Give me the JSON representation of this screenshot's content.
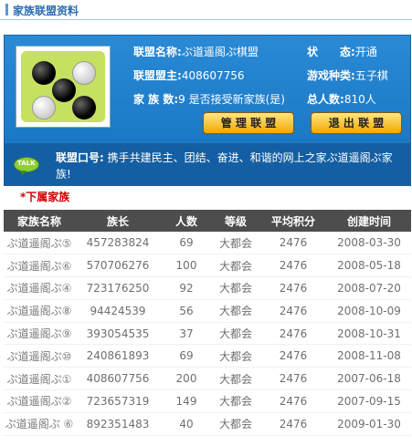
{
  "section_title": "家族联盟资料",
  "alliance": {
    "name_label": "联盟名称:",
    "name_value": "ぷ道遥阁ぷ棋盟",
    "leader_label": "联盟盟主:",
    "leader_value": "408607756",
    "families_label": "家 族 数:",
    "families_value": "9 是否接受新家族(是)",
    "status_label": "状　　态:",
    "status_value": "开通",
    "game_label": "游戏种类:",
    "game_value": "五子棋",
    "population_label": "总人数:",
    "population_value": "810人",
    "manage_button": "管 理 联 盟",
    "quit_button": "退 出 联 盟",
    "slogan_label": "联盟口号:",
    "slogan_value": "携手共建民主、团结、奋进、和谐的网上之家ぷ道遥阁ぷ家族!",
    "talk_icon_text": "TALK"
  },
  "sub_families_title": "*下属家族",
  "table": {
    "headers": [
      "家族名称",
      "族长",
      "人数",
      "等级",
      "平均积分",
      "创建时间"
    ],
    "rows": [
      {
        "name": "ぷ道遥阁ぷ⑤",
        "leader": "457283824",
        "members": "69",
        "level": "大都会",
        "avg": "2476",
        "created": "2008-03-30"
      },
      {
        "name": "ぷ道遥阁ぷ⑥",
        "leader": "570706276",
        "members": "100",
        "level": "大都会",
        "avg": "2476",
        "created": "2008-05-18"
      },
      {
        "name": "ぷ道遥阁ぷ④",
        "leader": "723176250",
        "members": "92",
        "level": "大都会",
        "avg": "2476",
        "created": "2008-07-20"
      },
      {
        "name": "ぷ道遥阁ぷ⑧",
        "leader": "94424539",
        "members": "56",
        "level": "大都会",
        "avg": "2476",
        "created": "2008-10-09"
      },
      {
        "name": "ぷ道遥阁ぷ⑨",
        "leader": "393054535",
        "members": "37",
        "level": "大都会",
        "avg": "2476",
        "created": "2008-10-31"
      },
      {
        "name": "ぷ道遥阁ぷ⑩",
        "leader": "240861893",
        "members": "69",
        "level": "大都会",
        "avg": "2476",
        "created": "2008-11-08"
      },
      {
        "name": "ぷ道遥阁ぷ①",
        "leader": "408607756",
        "members": "200",
        "level": "大都会",
        "avg": "2476",
        "created": "2007-06-18"
      },
      {
        "name": "ぷ道遥阁ぷ②",
        "leader": "723657319",
        "members": "149",
        "level": "大都会",
        "avg": "2476",
        "created": "2007-09-15"
      },
      {
        "name": "ぷ道遥阁ぷ ⑥",
        "leader": "892351483",
        "members": "40",
        "level": "大都会",
        "avg": "2476",
        "created": "2009-01-30"
      }
    ]
  }
}
